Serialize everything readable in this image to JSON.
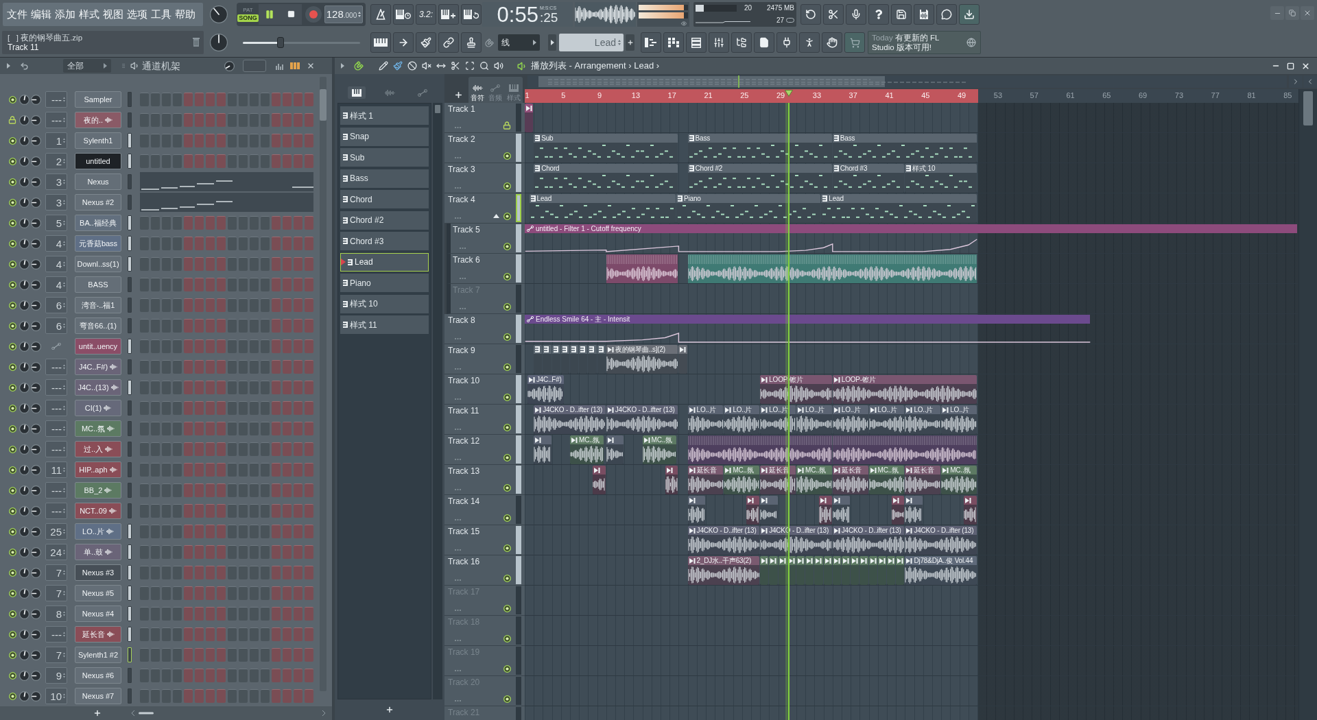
{
  "menu": [
    "文件",
    "编辑",
    "添加",
    "样式",
    "视图",
    "选项",
    "工具",
    "帮助"
  ],
  "transport": {
    "modes": [
      {
        "label": "PAT",
        "selected": false
      },
      {
        "label": "SONG",
        "selected": true
      }
    ],
    "playing": true,
    "tempo": "128",
    "tempo_fraction": ".000"
  },
  "record_tools": {
    "countdown": "3.2:"
  },
  "clock": {
    "time": "0:55",
    "hundredths": ":25",
    "format": "M:S:CS"
  },
  "output_meter": [
    {
      "level": 0.92
    },
    {
      "level": 0.92
    }
  ],
  "monitor": {
    "cpu_meter": {
      "level": 0.2
    },
    "cpu": "20",
    "memory": "2475 MB",
    "voices": "27"
  },
  "hint": {
    "title": "[   ] 夜的钢琴曲五.zip",
    "detail": "Track 11"
  },
  "master_pitch": {
    "level": 0.32
  },
  "snap": {
    "value": "线"
  },
  "pattern_selector": {
    "value": "Lead"
  },
  "news": {
    "day": "Today",
    "message": "有更新的 FL Studio 版本可用!"
  },
  "channel_rack": {
    "filter": "全部",
    "title": "通道机架",
    "channels": [
      {
        "route": "---",
        "name": "Sampler",
        "color": "#646e77",
        "sample": false,
        "selected": false,
        "focused": false,
        "locked": false,
        "muted": false,
        "kind": "steps"
      },
      {
        "route": "---",
        "name": "夜的..",
        "color": "#8a5a66",
        "sample": true,
        "selected": false,
        "focused": false,
        "locked": true,
        "muted": false,
        "kind": "steps"
      },
      {
        "route": "1",
        "name": "Sylenth1",
        "color": "#646e77",
        "sample": false,
        "selected": true,
        "focused": false,
        "locked": false,
        "muted": false,
        "kind": "steps"
      },
      {
        "route": "2",
        "name": "untitled",
        "color": "#1e2226",
        "sample": false,
        "selected": true,
        "focused": false,
        "locked": false,
        "muted": false,
        "kind": "steps"
      },
      {
        "route": "3",
        "name": "Nexus",
        "color": "#646e77",
        "sample": false,
        "selected": false,
        "focused": false,
        "locked": false,
        "muted": false,
        "kind": "piano_roll"
      },
      {
        "route": "3",
        "name": "Nexus #2",
        "color": "#646e77",
        "sample": false,
        "selected": false,
        "focused": false,
        "locked": false,
        "muted": false,
        "kind": "piano_roll"
      },
      {
        "route": "5",
        "name": "BA..福经典",
        "color": "#626f7e",
        "sample": false,
        "selected": true,
        "focused": false,
        "locked": false,
        "muted": false,
        "kind": "steps"
      },
      {
        "route": "4",
        "name": "元香菇bass",
        "color": "#5f6f86",
        "sample": false,
        "selected": true,
        "focused": false,
        "locked": false,
        "muted": false,
        "kind": "steps"
      },
      {
        "route": "4",
        "name": "Downl..ss(1)",
        "color": "#646e77",
        "sample": false,
        "selected": true,
        "focused": false,
        "locked": false,
        "muted": false,
        "kind": "steps"
      },
      {
        "route": "4",
        "name": "BASS",
        "color": "#646e77",
        "sample": false,
        "selected": false,
        "focused": false,
        "locked": false,
        "muted": false,
        "kind": "steps"
      },
      {
        "route": "6",
        "name": "湾音-..福1",
        "color": "#646e77",
        "sample": false,
        "selected": false,
        "focused": false,
        "locked": false,
        "muted": false,
        "kind": "steps"
      },
      {
        "route": "6",
        "name": "弯音66..(1)",
        "color": "#646e77",
        "sample": false,
        "selected": false,
        "focused": false,
        "locked": false,
        "muted": false,
        "kind": "steps"
      },
      {
        "name": "untit..uency",
        "color": "#8b4d67",
        "sample": false,
        "selected": true,
        "focused": false,
        "locked": false,
        "muted": false,
        "kind": "steps"
      },
      {
        "route": "---",
        "name": "J4C..F#)",
        "color": "#6a6478",
        "sample": true,
        "selected": false,
        "focused": false,
        "locked": false,
        "muted": false,
        "kind": "steps"
      },
      {
        "route": "---",
        "name": "J4C..(13)",
        "color": "#6a6478",
        "sample": true,
        "selected": true,
        "focused": false,
        "locked": false,
        "muted": false,
        "kind": "steps"
      },
      {
        "route": "---",
        "name": "CI(1)",
        "color": "#66697a",
        "sample": true,
        "selected": false,
        "focused": false,
        "locked": false,
        "muted": false,
        "kind": "steps"
      },
      {
        "route": "---",
        "name": "MC..氛",
        "color": "#5c7a62",
        "sample": true,
        "selected": false,
        "focused": false,
        "locked": false,
        "muted": false,
        "kind": "steps"
      },
      {
        "route": "---",
        "name": "过..入",
        "color": "#8a4d57",
        "sample": true,
        "selected": false,
        "focused": false,
        "locked": false,
        "muted": false,
        "kind": "steps"
      },
      {
        "route": "11",
        "name": "HIP..aph",
        "color": "#8a4d57",
        "sample": true,
        "selected": false,
        "focused": false,
        "locked": false,
        "muted": false,
        "kind": "steps"
      },
      {
        "route": "---",
        "name": "BB_2",
        "color": "#5c7a62",
        "sample": true,
        "selected": false,
        "focused": false,
        "locked": false,
        "muted": false,
        "kind": "steps"
      },
      {
        "route": "---",
        "name": "NCT..09",
        "color": "#8a4d57",
        "sample": true,
        "selected": false,
        "focused": false,
        "locked": false,
        "muted": false,
        "kind": "steps"
      },
      {
        "route": "25",
        "name": "LO..片",
        "color": "#5f6f86",
        "sample": true,
        "selected": true,
        "focused": false,
        "locked": false,
        "muted": false,
        "kind": "steps"
      },
      {
        "route": "24",
        "name": "单..鼓",
        "color": "#6a6478",
        "sample": true,
        "selected": true,
        "focused": false,
        "locked": false,
        "muted": false,
        "kind": "steps"
      },
      {
        "route": "7",
        "name": "Nexus #3",
        "color": "#474f57",
        "sample": false,
        "selected": true,
        "focused": false,
        "locked": false,
        "muted": false,
        "kind": "steps"
      },
      {
        "route": "7",
        "name": "Nexus #5",
        "color": "#646e77",
        "sample": false,
        "selected": true,
        "focused": false,
        "locked": false,
        "muted": false,
        "kind": "steps"
      },
      {
        "route": "8",
        "name": "Nexus #4",
        "color": "#646e77",
        "sample": false,
        "selected": true,
        "focused": false,
        "locked": false,
        "muted": false,
        "kind": "steps"
      },
      {
        "route": "---",
        "name": "延长音",
        "color": "#8a4d57",
        "sample": true,
        "selected": true,
        "focused": false,
        "locked": false,
        "muted": false,
        "kind": "steps"
      },
      {
        "route": "7",
        "name": "Sylenth1 #2",
        "color": "#646e77",
        "sample": false,
        "selected": false,
        "focused": true,
        "locked": false,
        "muted": false,
        "kind": "steps"
      },
      {
        "route": "9",
        "name": "Nexus #6",
        "color": "#646e77",
        "sample": false,
        "selected": false,
        "focused": false,
        "locked": false,
        "muted": false,
        "kind": "steps"
      },
      {
        "route": "10",
        "name": "Nexus #7",
        "color": "#646e77",
        "sample": false,
        "selected": false,
        "focused": false,
        "locked": false,
        "muted": false,
        "kind": "steps"
      }
    ]
  },
  "playlist": {
    "title": "播放列表 - Arrangement › Lead ›",
    "picker_tabs": [
      {
        "kind": "patterns",
        "selected": true
      },
      {
        "kind": "audio",
        "selected": false
      },
      {
        "kind": "automation",
        "selected": false
      }
    ],
    "patterns": [
      {
        "name": "样式 1",
        "selected": false
      },
      {
        "name": "Snap",
        "selected": false
      },
      {
        "name": "Sub",
        "selected": false
      },
      {
        "name": "Bass",
        "selected": false
      },
      {
        "name": "Chord",
        "selected": false
      },
      {
        "name": "Chord #2",
        "selected": false
      },
      {
        "name": "Chord #3",
        "selected": false
      },
      {
        "name": "Lead",
        "selected": true
      },
      {
        "name": "Piano",
        "selected": false
      },
      {
        "name": "样式 10",
        "selected": false
      },
      {
        "name": "样式 11",
        "selected": false
      }
    ],
    "view_tabs": [
      {
        "kind": "audio",
        "label": "音符",
        "selected": true
      },
      {
        "kind": "automation",
        "label": "音频",
        "selected": false
      },
      {
        "kind": "patterns",
        "label": "样式",
        "selected": false
      }
    ],
    "ruler": [
      "1",
      "5",
      "9",
      "13",
      "17",
      "21",
      "25",
      "29",
      "33",
      "37",
      "41",
      "45",
      "49",
      "53",
      "57",
      "61",
      "65",
      "69",
      "73",
      "77",
      "81",
      "85"
    ],
    "playhead": {
      "level": 0.3413
    },
    "tracks": [
      {
        "name": "Track 1",
        "locked": true,
        "muted": false,
        "selected": false,
        "focused": false,
        "dimmed": false,
        "clips": [
          {
            "kind": "audio",
            "color": "#93507a"
          }
        ]
      },
      {
        "name": "Track 2",
        "locked": false,
        "muted": false,
        "selected": true,
        "focused": false,
        "dimmed": false,
        "clips": [
          {
            "kind": "pattern",
            "label": "Sub",
            "color": "#5b6670"
          },
          {
            "kind": "pattern",
            "label": "Bass",
            "color": "#5b6670"
          },
          {
            "kind": "pattern",
            "label": "Bass",
            "color": "#5b6670"
          }
        ]
      },
      {
        "name": "Track 3",
        "locked": false,
        "muted": false,
        "selected": true,
        "focused": false,
        "dimmed": false,
        "clips": [
          {
            "kind": "pattern",
            "label": "Chord",
            "color": "#5b6670"
          },
          {
            "kind": "pattern",
            "label": "Chord #2",
            "color": "#5b6670"
          },
          {
            "kind": "pattern",
            "label": "Chord #3",
            "color": "#5b6670"
          },
          {
            "kind": "pattern",
            "label": "样式 10",
            "color": "#5b6670"
          }
        ]
      },
      {
        "name": "Track 4",
        "locked": false,
        "muted": false,
        "selected": true,
        "focused": true,
        "dimmed": false,
        "expanded": true,
        "clips": [
          {
            "kind": "pattern",
            "label": "Lead",
            "color": "#5b6670"
          },
          {
            "kind": "pattern",
            "label": "Piano",
            "color": "#5b6670"
          },
          {
            "kind": "pattern",
            "label": "Lead",
            "color": "#5b6670"
          }
        ],
        "children": [
          {
            "name": "Track 5",
            "locked": false,
            "muted": false,
            "selected": true,
            "focused": false,
            "dimmed": false,
            "clips": [
              {
                "kind": "automation",
                "label": "untitled - Filter 1 - Cutoff frequency",
                "color": "#8d4b7c"
              }
            ]
          },
          {
            "name": "Track 6",
            "locked": false,
            "muted": false,
            "selected": true,
            "focused": false,
            "dimmed": false,
            "clips": [
              {
                "kind": "dense",
                "color": "#7d4a6a"
              },
              {
                "kind": "dense",
                "color": "#3f7a74"
              }
            ]
          },
          {
            "name": "Track 7",
            "locked": false,
            "muted": false,
            "selected": false,
            "focused": false,
            "dimmed": true
          }
        ]
      },
      {
        "name": "Track 8",
        "locked": false,
        "muted": false,
        "selected": true,
        "focused": false,
        "dimmed": false,
        "clips": [
          {
            "kind": "automation",
            "label": "Endless Smile 64 - 主 - Intensit",
            "color": "#6b4a8e"
          }
        ]
      },
      {
        "name": "Track 9",
        "locked": false,
        "muted": false,
        "selected": false,
        "focused": false,
        "dimmed": false,
        "clips": [
          {
            "kind": "pattern",
            "color": "#5b6670"
          },
          {
            "kind": "pattern",
            "color": "#5b6670"
          },
          {
            "kind": "pattern",
            "color": "#5b6670"
          },
          {
            "kind": "pattern",
            "color": "#5b6670"
          },
          {
            "kind": "pattern",
            "color": "#5b6670"
          },
          {
            "kind": "pattern",
            "color": "#5b6670"
          },
          {
            "kind": "pattern",
            "color": "#5b6670"
          },
          {
            "kind": "pattern",
            "color": "#5b6670"
          },
          {
            "kind": "audio",
            "label": "夜的钢琴曲..s](2)",
            "color": "#6b6f77"
          },
          {
            "kind": "audio",
            "color": "#6b6f77"
          }
        ]
      },
      {
        "name": "Track 10",
        "locked": false,
        "muted": false,
        "selected": true,
        "focused": false,
        "dimmed": false,
        "clips": [
          {
            "kind": "audio",
            "label": "J4C..F#)",
            "color": "#5d6478"
          },
          {
            "kind": "audio",
            "label": "LOOP-镲片",
            "color": "#7a5670"
          },
          {
            "kind": "audio",
            "label": "LOOP-镲片",
            "color": "#7a5670"
          }
        ]
      },
      {
        "name": "Track 11",
        "locked": false,
        "muted": false,
        "selected": true,
        "focused": false,
        "dimmed": false,
        "clips": [
          {
            "kind": "audio",
            "label": "J4CKO - D..ifter (13)",
            "color": "#5f6275"
          },
          {
            "kind": "audio",
            "label": "J4CKO - D..ifter (13)",
            "color": "#5f6275"
          },
          {
            "kind": "audio",
            "label": "LO..片",
            "color": "#5b6473"
          },
          {
            "kind": "audio",
            "label": "LO..片",
            "color": "#5b6473"
          },
          {
            "kind": "audio",
            "label": "LO..片",
            "color": "#5b6473"
          },
          {
            "kind": "audio",
            "label": "LO..片",
            "color": "#5b6473"
          },
          {
            "kind": "audio",
            "label": "LO..片",
            "color": "#5b6473"
          },
          {
            "kind": "audio",
            "label": "LO..片",
            "color": "#5b6473"
          },
          {
            "kind": "audio",
            "label": "LO..片",
            "color": "#5b6473"
          },
          {
            "kind": "audio",
            "label": "LO..片",
            "color": "#5b6473"
          }
        ]
      },
      {
        "name": "Track 12",
        "locked": false,
        "muted": false,
        "selected": true,
        "focused": false,
        "dimmed": false,
        "clips": [
          {
            "kind": "audio",
            "color": "#5b6473"
          },
          {
            "kind": "audio",
            "label": "MC..氛",
            "color": "#5d7a63"
          },
          {
            "kind": "audio",
            "color": "#5b6473"
          },
          {
            "kind": "audio",
            "label": "MC..氛",
            "color": "#5d7a63"
          },
          {
            "kind": "dense",
            "color": "#4e3f5e"
          },
          {
            "kind": "dense",
            "color": "#4e3f5e"
          }
        ]
      },
      {
        "name": "Track 13",
        "locked": false,
        "muted": false,
        "selected": true,
        "focused": false,
        "dimmed": false,
        "clips": [
          {
            "kind": "audio",
            "color": "#7a4d62"
          },
          {
            "kind": "audio",
            "color": "#7a4d62"
          },
          {
            "kind": "audio",
            "label": "延长音",
            "color": "#7a5a70"
          },
          {
            "kind": "audio",
            "label": "MC..氛",
            "color": "#5d7a63"
          },
          {
            "kind": "audio",
            "label": "延长音",
            "color": "#7a5a70"
          },
          {
            "kind": "audio",
            "label": "MC..氛",
            "color": "#5d7a63"
          },
          {
            "kind": "audio",
            "label": "延长音",
            "color": "#7a5a70"
          },
          {
            "kind": "audio",
            "label": "MC..氛",
            "color": "#5d7a63"
          },
          {
            "kind": "audio",
            "label": "延长音",
            "color": "#7a5a70"
          },
          {
            "kind": "audio",
            "label": "MC..氛",
            "color": "#5d7a63"
          }
        ]
      },
      {
        "name": "Track 14",
        "locked": false,
        "muted": false,
        "selected": false,
        "focused": false,
        "dimmed": false,
        "clips": [
          {
            "kind": "audio",
            "color": "#5b6473"
          },
          {
            "kind": "audio",
            "color": "#7a4d62"
          },
          {
            "kind": "audio",
            "color": "#5b6473"
          },
          {
            "kind": "audio",
            "color": "#7a4d62"
          },
          {
            "kind": "audio",
            "color": "#5b6473"
          },
          {
            "kind": "audio",
            "color": "#7a4d62"
          },
          {
            "kind": "audio",
            "color": "#5b6473"
          },
          {
            "kind": "audio",
            "color": "#7a4d62"
          }
        ]
      },
      {
        "name": "Track 15",
        "locked": false,
        "muted": false,
        "selected": true,
        "focused": false,
        "dimmed": false,
        "clips": [
          {
            "kind": "audio",
            "label": "J4CKO - D..ifter (13)",
            "color": "#5f6275"
          },
          {
            "kind": "audio",
            "label": "J4CKO - D..ifter (13)",
            "color": "#5f6275"
          },
          {
            "kind": "audio",
            "label": "J4CKO - D..ifter (13)",
            "color": "#5f6275"
          },
          {
            "kind": "audio",
            "label": "J4CKO - D..ifter (13)",
            "color": "#5f6275"
          }
        ]
      },
      {
        "name": "Track 16",
        "locked": false,
        "muted": false,
        "selected": true,
        "focused": false,
        "dimmed": false,
        "clips": [
          {
            "kind": "audio",
            "label": "2_DJ水..干声63(2)",
            "color": "#7a5a70"
          },
          {
            "kind": "audio",
            "color": "#5d7a63"
          },
          {
            "kind": "audio",
            "color": "#5d7a63"
          },
          {
            "kind": "audio",
            "color": "#5d7a63"
          },
          {
            "kind": "audio",
            "color": "#5d7a63"
          },
          {
            "kind": "audio",
            "color": "#5d7a63"
          },
          {
            "kind": "audio",
            "color": "#5d7a63"
          },
          {
            "kind": "audio",
            "color": "#5d7a63"
          },
          {
            "kind": "audio",
            "color": "#5d7a63"
          },
          {
            "kind": "audio",
            "color": "#5d7a63"
          },
          {
            "kind": "audio",
            "color": "#5d7a63"
          },
          {
            "kind": "audio",
            "color": "#5d7a63"
          },
          {
            "kind": "audio",
            "color": "#5d7a63"
          },
          {
            "kind": "audio",
            "color": "#5d7a63"
          },
          {
            "kind": "audio",
            "color": "#5d7a63"
          },
          {
            "kind": "audio",
            "color": "#5d7a63"
          },
          {
            "kind": "audio",
            "color": "#5d7a63"
          },
          {
            "kind": "audio",
            "label": "Dj78&DjA..俊 Vol.44",
            "color": "#5f6a7a"
          }
        ]
      },
      {
        "name": "Track 17",
        "locked": false,
        "muted": false,
        "selected": false,
        "focused": false,
        "dimmed": true
      },
      {
        "name": "Track 18",
        "locked": false,
        "muted": false,
        "selected": false,
        "focused": false,
        "dimmed": true
      },
      {
        "name": "Track 19",
        "locked": false,
        "muted": false,
        "selected": false,
        "focused": false,
        "dimmed": true
      },
      {
        "name": "Track 20",
        "locked": false,
        "muted": false,
        "selected": false,
        "focused": false,
        "dimmed": true
      },
      {
        "name": "Track 21",
        "selected": false,
        "focused": false,
        "dimmed": true
      }
    ]
  }
}
